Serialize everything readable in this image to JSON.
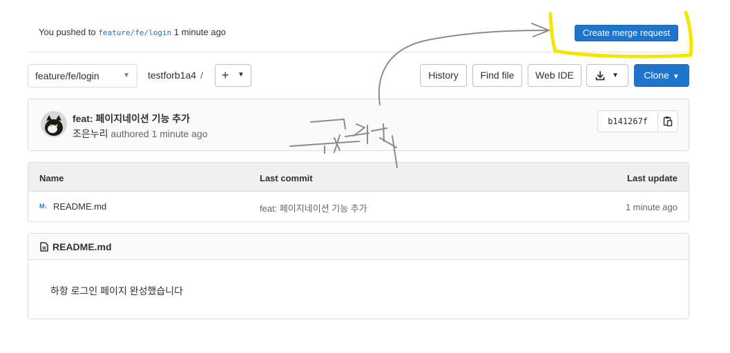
{
  "push_banner": {
    "text_prefix": "You pushed to",
    "branch": "feature/fe/login",
    "time": "1 minute ago",
    "create_mr_label": "Create merge request"
  },
  "branch_selector": {
    "value": "feature/fe/login"
  },
  "breadcrumb": {
    "project": "testforb1a4",
    "separator": "/"
  },
  "toolbar": {
    "history_label": "History",
    "find_file_label": "Find file",
    "web_ide_label": "Web IDE",
    "download_icon": "download-icon",
    "clone_label": "Clone"
  },
  "last_commit": {
    "title": "feat: 페이지네이션 기능 추가",
    "author": "조은누리",
    "authored_text": "authored 1 minute ago",
    "sha": "b141267f"
  },
  "file_table": {
    "columns": [
      "Name",
      "Last commit",
      "Last update"
    ],
    "rows": [
      {
        "icon": "M↓",
        "name": "README.md",
        "commit": "feat: 페이지네이션 기능 추가",
        "updated": "1 minute ago"
      }
    ]
  },
  "readme": {
    "title": "README.md",
    "content": "하항 로그인 페이지 완성했습니다"
  },
  "annotation": {
    "highlight_color": "#f5e600",
    "pen_color": "#8a8a8a"
  }
}
